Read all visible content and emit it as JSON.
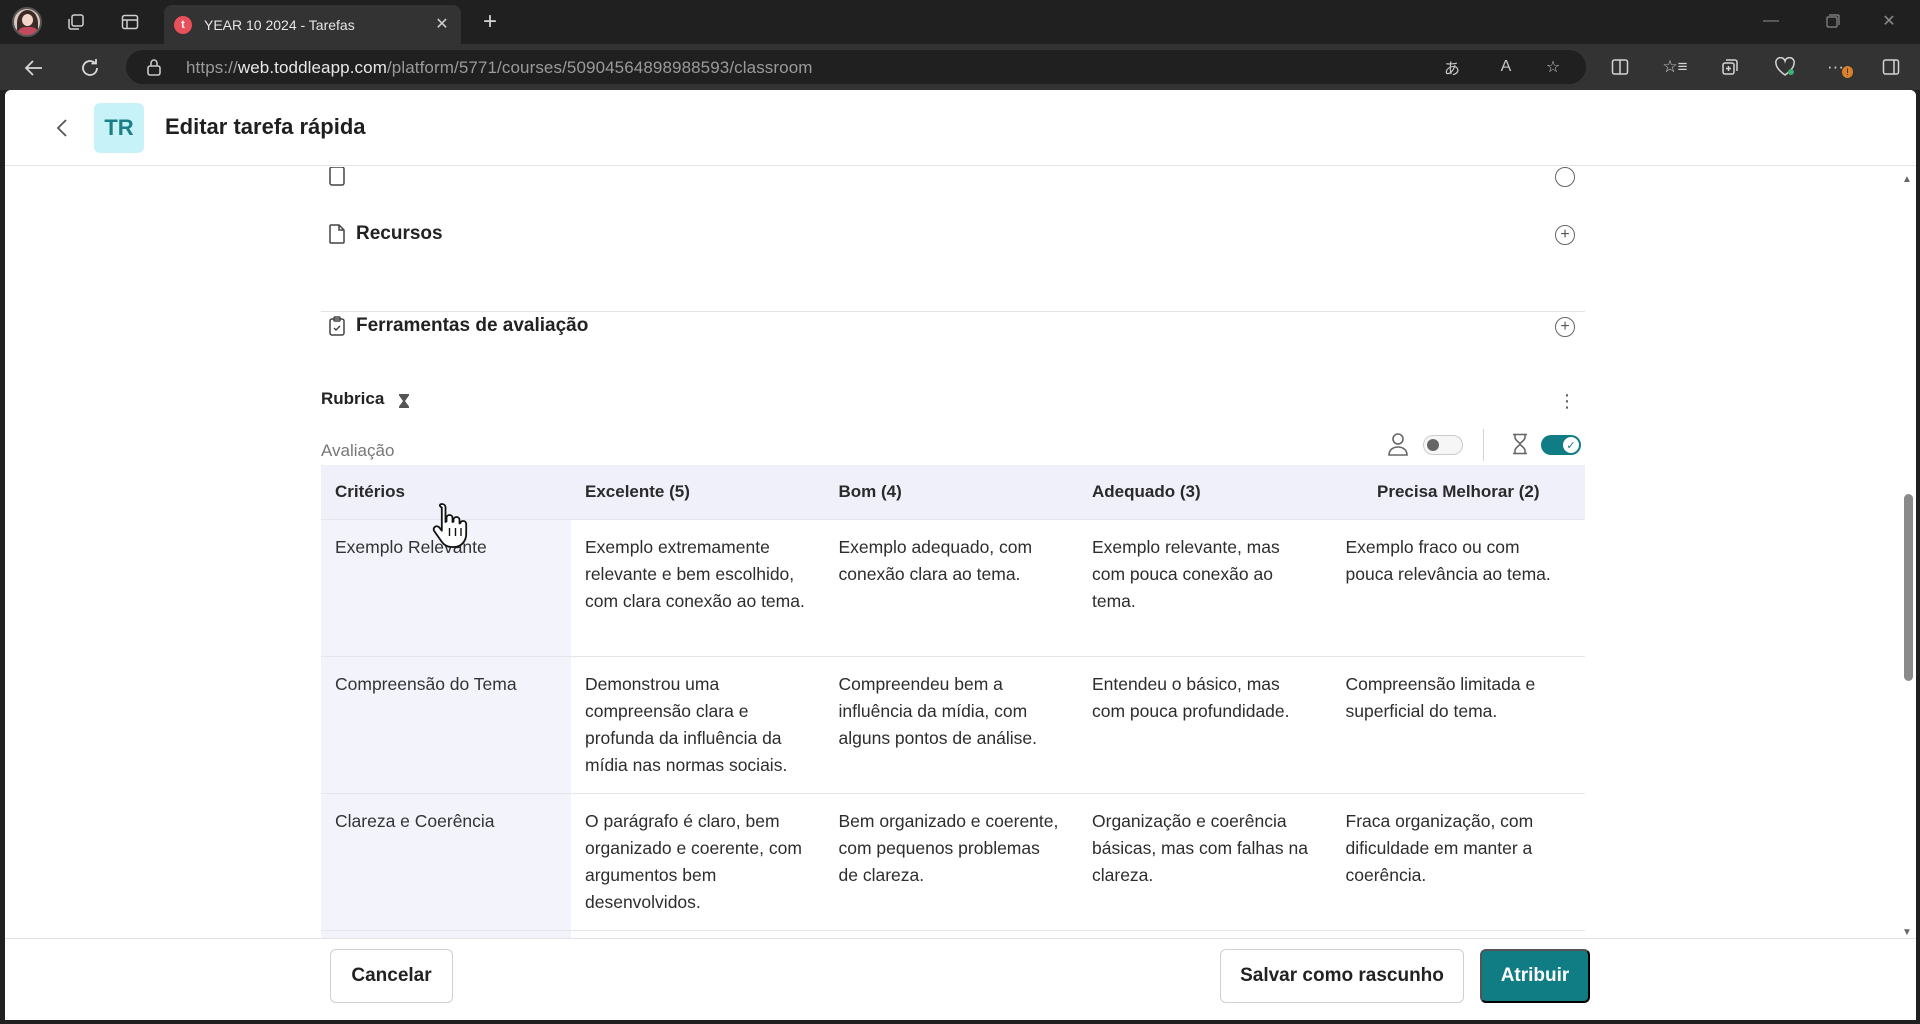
{
  "browser": {
    "tab_title": "YEAR 10 2024 - Tarefas",
    "tab_favicon_letter": "t",
    "url_prefix": "https://",
    "url_host": "web.toddleapp.com",
    "url_path": "/platform/5771/courses/50904564898988593/classroom",
    "extensions_badge": "!"
  },
  "header": {
    "avatar_initials": "TR",
    "title": "Editar tarefa rápida"
  },
  "sections": {
    "resources_label": "Recursos",
    "assessment_tools_label": "Ferramentas de avaliação"
  },
  "rubric": {
    "label": "Rubrica",
    "evaluation_label": "Avaliação",
    "student_toggle_on": false,
    "hourglass_toggle_on": true
  },
  "table": {
    "headers": [
      "Critérios",
      "Excelente (5)",
      "Bom (4)",
      "Adequado (3)",
      "Precisa Melhorar (2)"
    ],
    "rows": [
      {
        "criterion": "Exemplo Relevante",
        "cells": [
          "Exemplo extremamente relevante e bem escolhido, com clara conexão ao tema.",
          "Exemplo adequado, com conexão clara ao tema.",
          "Exemplo relevante, mas com pouca conexão ao tema.",
          "Exemplo fraco ou com pouca relevância ao tema."
        ]
      },
      {
        "criterion": "Compreensão do Tema",
        "cells": [
          "Demonstrou uma compreensão clara e profunda da influência da mídia nas normas sociais.",
          "Compreendeu bem a influência da mídia, com alguns pontos de análise.",
          "Entendeu o básico, mas com pouca profundidade.",
          "Compreensão limitada e superficial do tema."
        ]
      },
      {
        "criterion": "Clareza e Coerência",
        "cells": [
          "O parágrafo é claro, bem organizado e coerente, com argumentos bem desenvolvidos.",
          "Bem organizado e coerente, com pequenos problemas de clareza.",
          "Organização e coerência básicas, mas com falhas na clareza.",
          "Fraca organização, com dificuldade em manter a coerência."
        ]
      }
    ]
  },
  "footer": {
    "cancel_label": "Cancelar",
    "draft_label": "Salvar como rascunho",
    "assign_label": "Atribuir"
  },
  "colors": {
    "accent": "#107c84",
    "avatar_bg": "#c7f3f8",
    "table_header_bg": "#eff0fa"
  }
}
